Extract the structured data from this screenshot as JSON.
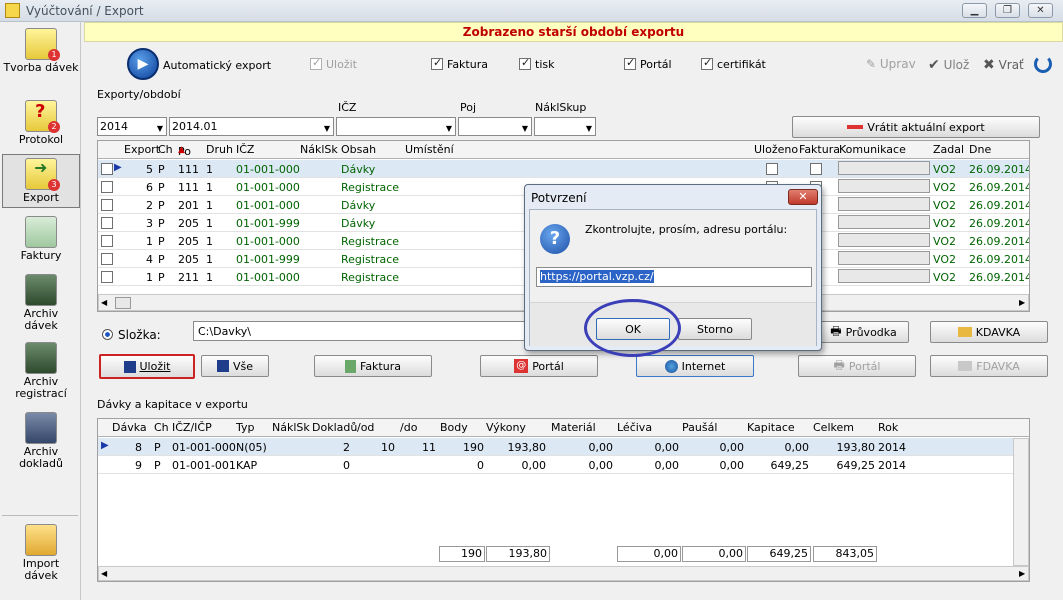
{
  "window": {
    "title": "Vyúčtování / Export"
  },
  "banner": "Zobrazeno starší období exportu",
  "sidebar": [
    {
      "label": "Tvorba dávek",
      "badge": "1"
    },
    {
      "label": "Protokol",
      "badge": "2"
    },
    {
      "label": "Export",
      "badge": "3"
    },
    {
      "label": "Faktury"
    },
    {
      "label": "Archiv dávek"
    },
    {
      "label": "Archiv registrací"
    },
    {
      "label": "Archiv dokladů"
    },
    {
      "label": "Import dávek"
    }
  ],
  "toolbar": {
    "auto_export": "Automatický export",
    "ulozit": "Uložit",
    "faktura": "Faktura",
    "tisk": "tisk",
    "portal": "Portál",
    "certifikat": "certifikát",
    "uprav": "Uprav",
    "uloz": "Ulož",
    "vrat": "Vrať"
  },
  "exports": {
    "title": "Exporty/období",
    "filters": {
      "year": "2014",
      "period": "2014.01",
      "icz_label": "IČZ",
      "poj_label": "Poj",
      "naklskup_label": "NáklSkup"
    },
    "revert_button": "Vrátit aktuální export",
    "columns": [
      "Export",
      "Ch",
      "Po",
      "Druh",
      "IČZ",
      "NáklSk",
      "Obsah",
      "Umístění",
      "Uloženo",
      "Faktura",
      "Komunikace",
      "Zadal",
      "Dne"
    ],
    "rows": [
      {
        "export": "5",
        "ch": "P",
        "po": "111",
        "druh": "1",
        "icz": "01-001-000",
        "obsah": "Dávky",
        "zadal": "VO2",
        "dne": "26.09.2014"
      },
      {
        "export": "6",
        "ch": "P",
        "po": "111",
        "druh": "1",
        "icz": "01-001-000",
        "obsah": "Registrace",
        "zadal": "VO2",
        "dne": "26.09.2014"
      },
      {
        "export": "2",
        "ch": "P",
        "po": "201",
        "druh": "1",
        "icz": "01-001-000",
        "obsah": "Dávky",
        "zadal": "VO2",
        "dne": "26.09.2014"
      },
      {
        "export": "3",
        "ch": "P",
        "po": "205",
        "druh": "1",
        "icz": "01-001-999",
        "obsah": "Dávky",
        "zadal": "VO2",
        "dne": "26.09.2014"
      },
      {
        "export": "1",
        "ch": "P",
        "po": "205",
        "druh": "1",
        "icz": "01-001-000",
        "obsah": "Registrace",
        "zadal": "VO2",
        "dne": "26.09.2014"
      },
      {
        "export": "4",
        "ch": "P",
        "po": "205",
        "druh": "1",
        "icz": "01-001-999",
        "obsah": "Registrace",
        "zadal": "VO2",
        "dne": "26.09.2014"
      },
      {
        "export": "1",
        "ch": "P",
        "po": "211",
        "druh": "1",
        "icz": "01-001-000",
        "obsah": "Registrace",
        "zadal": "VO2",
        "dne": "26.09.2014"
      }
    ]
  },
  "folder": {
    "label": "Složka:",
    "value": "C:\\Davky\\"
  },
  "buttons": {
    "ulozit": "Uložit",
    "vse": "Vše",
    "faktura": "Faktura",
    "portal": "Portál",
    "internet": "Internet",
    "pruvodka": "Průvodka",
    "kdavka": "KDAVKA",
    "portal2": "Portál",
    "fdavka": "FDAVKA"
  },
  "batches": {
    "title": "Dávky a kapitace v exportu",
    "columns": [
      "Dávka",
      "Ch",
      "IČZ/IČP",
      "Typ",
      "NáklSk",
      "Dokladů",
      "/od",
      "/do",
      "Body",
      "Výkony",
      "Materiál",
      "Léčiva",
      "Paušál",
      "Kapitace",
      "Celkem",
      "Rok"
    ],
    "rows": [
      {
        "davka": "8",
        "ch": "P",
        "icz": "01-001-000",
        "typ": "N(05)",
        "doklady": "2",
        "od": "10",
        "do": "11",
        "body": "190",
        "vykony": "193,80",
        "material": "0,00",
        "leciva": "0,00",
        "pausal": "0,00",
        "kapitace": "0,00",
        "celkem": "193,80",
        "rok": "2014"
      },
      {
        "davka": "9",
        "ch": "P",
        "icz": "01-001-001",
        "typ": "KAP",
        "doklady": "0",
        "od": "",
        "do": "",
        "body": "0",
        "vykony": "0,00",
        "material": "0,00",
        "leciva": "0,00",
        "pausal": "0,00",
        "kapitace": "649,25",
        "celkem": "649,25",
        "rok": "2014"
      }
    ],
    "totals": {
      "body": "190",
      "vykony": "193,80",
      "leciva": "0,00",
      "pausal": "0,00",
      "kapitace": "649,25",
      "celkem": "843,05"
    }
  },
  "dialog": {
    "title": "Potvrzení",
    "message": "Zkontrolujte, prosím, adresu portálu:",
    "url": "https://portal.vzp.cz/",
    "ok": "OK",
    "cancel": "Storno"
  },
  "colors": {
    "green_text": "#006400",
    "banner_text": "#c00000",
    "highlight_circle": "#3a3fb8"
  }
}
